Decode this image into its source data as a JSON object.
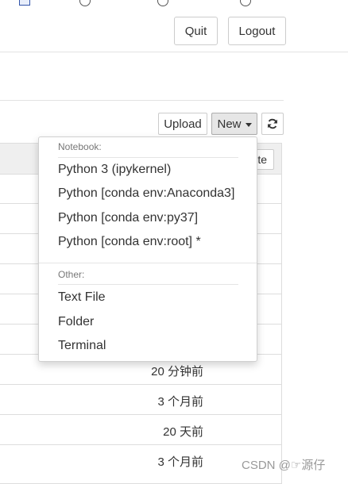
{
  "header": {
    "quit_label": "Quit",
    "logout_label": "Logout"
  },
  "toolbar": {
    "upload_label": "Upload",
    "new_label": "New"
  },
  "file_list": {
    "header_button_fragment": "te",
    "rows": [
      {
        "modified": ""
      },
      {
        "modified": ""
      },
      {
        "modified": ""
      },
      {
        "modified": ""
      },
      {
        "modified": ""
      },
      {
        "modified": ""
      },
      {
        "modified": "20 分钟前"
      },
      {
        "modified": "3 个月前"
      },
      {
        "modified": "20 天前"
      },
      {
        "modified": "3 个月前"
      }
    ]
  },
  "new_menu": {
    "notebook_header": "Notebook:",
    "notebook_items": [
      "Python 3 (ipykernel)",
      "Python [conda env:Anaconda3]",
      "Python [conda env:py37]",
      "Python [conda env:root] *"
    ],
    "other_header": "Other:",
    "other_items": [
      "Text File",
      "Folder",
      "Terminal"
    ]
  },
  "watermark": "CSDN @☞源仔"
}
